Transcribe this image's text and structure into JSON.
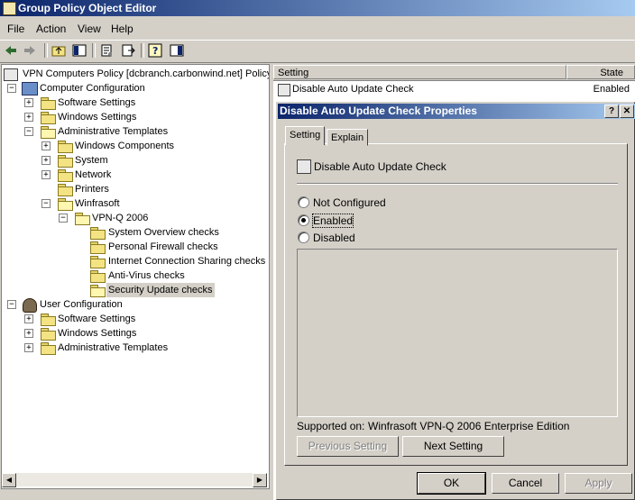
{
  "window": {
    "title": "Group Policy Object Editor",
    "icon": "gpo-editor-icon"
  },
  "menu": {
    "items": [
      "File",
      "Action",
      "View",
      "Help"
    ]
  },
  "toolbar": {
    "icons": [
      "back-arrow-icon",
      "forward-arrow-icon",
      "up-folder-icon",
      "show-hide-tree-icon",
      "properties-icon",
      "export-list-icon",
      "help-icon",
      "show-hide-action-pane-icon"
    ]
  },
  "tree": {
    "root": "VPN Computers Policy [dcbranch.carbonwind.net] Policy",
    "computer_configuration": "Computer Configuration",
    "cc_software_settings": "Software Settings",
    "cc_windows_settings": "Windows Settings",
    "cc_admin_templates": "Administrative Templates",
    "windows_components": "Windows Components",
    "system": "System",
    "network": "Network",
    "printers": "Printers",
    "winfrasoft": "Winfrasoft",
    "vpnq": "VPN-Q 2006",
    "system_overview_checks": "System Overview checks",
    "personal_firewall_checks": "Personal Firewall checks",
    "ics_checks": "Internet Connection Sharing checks",
    "antivirus_checks": "Anti-Virus checks",
    "security_update_checks": "Security Update checks",
    "user_configuration": "User Configuration",
    "uc_software_settings": "Software Settings",
    "uc_windows_settings": "Windows Settings",
    "uc_admin_templates": "Administrative Templates"
  },
  "list": {
    "col_setting": "Setting",
    "col_state": "State",
    "rows": [
      {
        "setting": "Disable Auto Update Check",
        "state": "Enabled"
      }
    ]
  },
  "dialog": {
    "title": "Disable Auto Update Check Properties",
    "help_btn": "?",
    "close_btn": "✕",
    "tabs": [
      "Setting",
      "Explain"
    ],
    "setting_name": "Disable Auto Update Check",
    "options": [
      "Not Configured",
      "Enabled",
      "Disabled"
    ],
    "selected_option": "Enabled",
    "supported_on_label": "Supported on:",
    "supported_on_value": "Winfrasoft VPN-Q 2006 Enterprise Edition",
    "prev_btn": "Previous Setting",
    "next_btn": "Next Setting",
    "ok_btn": "OK",
    "cancel_btn": "Cancel",
    "apply_btn": "Apply"
  },
  "colors": {
    "titlebar_start": "#0a246a",
    "titlebar_end": "#a6caf0",
    "face": "#d4d0c8"
  }
}
